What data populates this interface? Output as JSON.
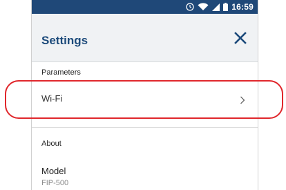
{
  "status_bar": {
    "time": "16:59",
    "icons": [
      "alarm-clock-icon",
      "wifi-icon",
      "cell-signal-icon",
      "battery-icon"
    ]
  },
  "app_bar": {
    "title": "Settings",
    "close_icon": "close-icon"
  },
  "sections": {
    "parameters": {
      "header": "Parameters",
      "items": [
        {
          "label": "Wi-Fi",
          "icon": "chevron-right-icon"
        }
      ]
    },
    "about": {
      "header": "About",
      "model_label": "Model",
      "model_value": "FIP-500"
    }
  },
  "colors": {
    "status_bar": "#1f4878",
    "title": "#1d4b7b",
    "app_bar_bg": "#f0f2f4",
    "highlight": "#e0262b"
  }
}
